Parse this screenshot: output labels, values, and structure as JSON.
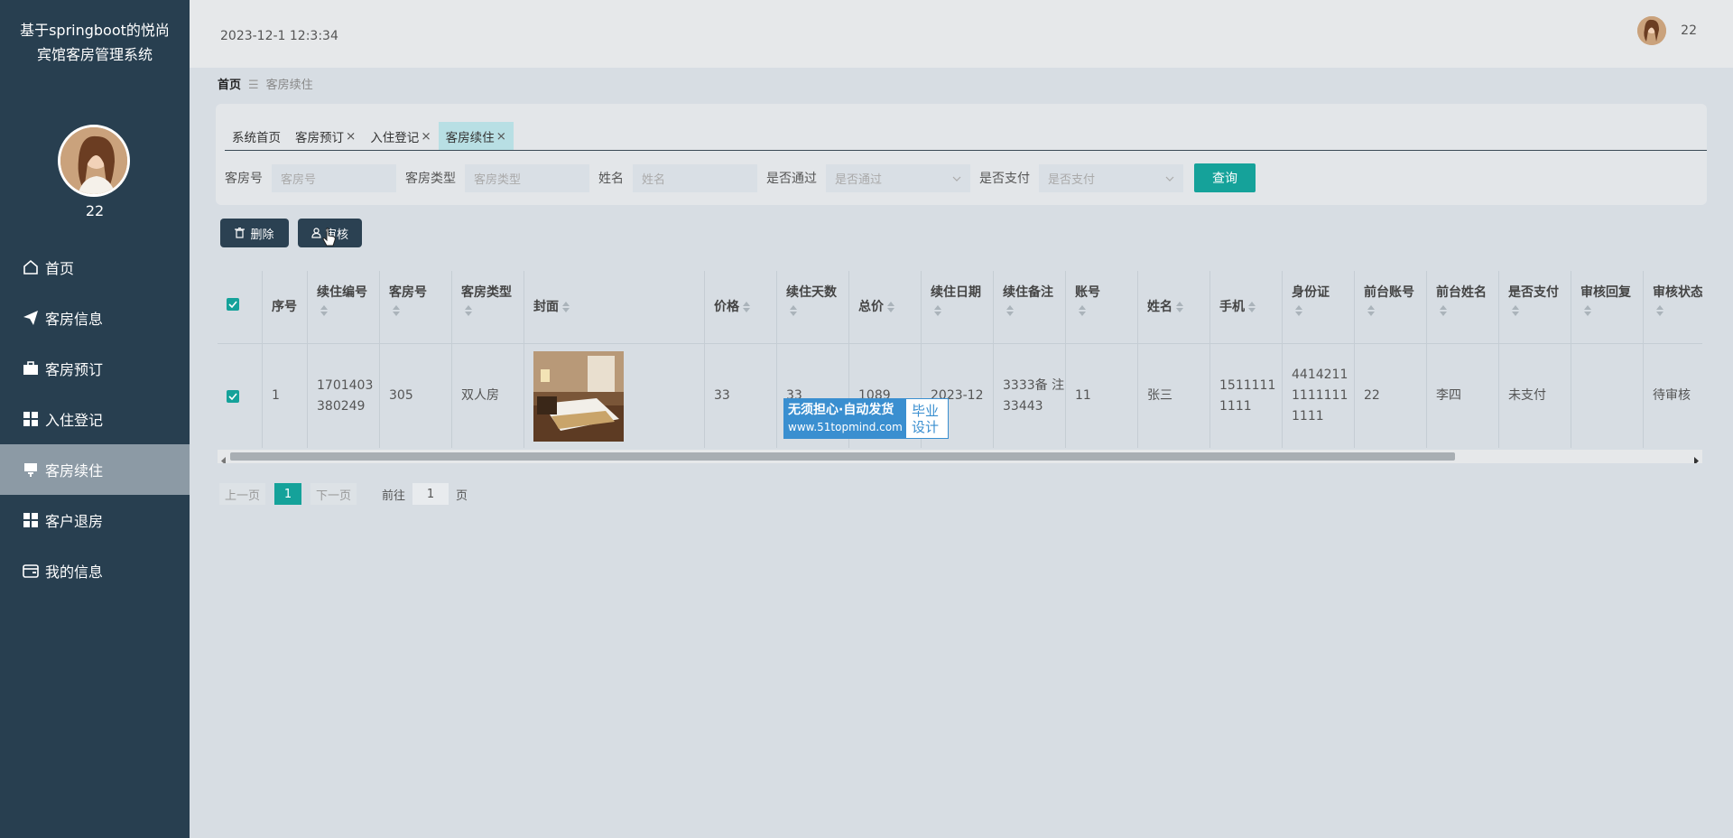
{
  "app": {
    "title": "基于springboot的悦尚宾馆客房管理系统",
    "user": "22"
  },
  "header": {
    "datetime": "2023-12-1 12:3:34",
    "user": "22"
  },
  "sidebar": {
    "items": [
      {
        "label": "首页",
        "icon": "home-icon"
      },
      {
        "label": "客房信息",
        "icon": "paper-plane-icon"
      },
      {
        "label": "客房预订",
        "icon": "briefcase-icon"
      },
      {
        "label": "入住登记",
        "icon": "grid-icon"
      },
      {
        "label": "客房续住",
        "icon": "monitor-icon",
        "active": true
      },
      {
        "label": "客户退房",
        "icon": "grid-icon"
      },
      {
        "label": "我的信息",
        "icon": "wallet-icon"
      }
    ]
  },
  "breadcrumb": {
    "home": "首页",
    "separator": "☰",
    "current": "客房续住"
  },
  "tabs": [
    {
      "label": "系统首页",
      "closable": false
    },
    {
      "label": "客房预订",
      "closable": true
    },
    {
      "label": "入住登记",
      "closable": true
    },
    {
      "label": "客房续住",
      "closable": true,
      "active": true
    }
  ],
  "close_glyph": "×",
  "search": {
    "room_no_label": "客房号",
    "room_no_placeholder": "客房号",
    "room_type_label": "客房类型",
    "room_type_placeholder": "客房类型",
    "name_label": "姓名",
    "name_placeholder": "姓名",
    "approved_label": "是否通过",
    "approved_placeholder": "是否通过",
    "paid_label": "是否支付",
    "paid_placeholder": "是否支付",
    "query_button": "查询"
  },
  "actions": {
    "delete": "删除",
    "review": "审核"
  },
  "table": {
    "headers": {
      "index": "序号",
      "renew_no": "续住编号",
      "room_no": "客房号",
      "room_type": "客房类型",
      "cover": "封面",
      "price": "价格",
      "days": "续住天数",
      "total": "总价",
      "date": "续住日期",
      "remark": "续住备注",
      "account": "账号",
      "name": "姓名",
      "phone": "手机",
      "id_card": "身份证",
      "desk_account": "前台账号",
      "desk_name": "前台姓名",
      "paid": "是否支付",
      "reply": "审核回复",
      "status": "审核状态"
    },
    "row": {
      "index": "1",
      "renew_no": "1701403 380249",
      "room_no": "305",
      "room_type": "双人房",
      "price": "33",
      "days": "33",
      "total": "1089",
      "date": "2023-12",
      "remark": "3333备 注33443",
      "account": "11",
      "name": "张三",
      "phone": "1511111 1111",
      "id_card": "4414211 1111111 1111",
      "desk_account": "22",
      "desk_name": "李四",
      "paid": "未支付",
      "reply": "",
      "status": "待审核"
    }
  },
  "pagination": {
    "prev": "上一页",
    "current": "1",
    "next": "下一页",
    "goto": "前往",
    "goto_value": "1",
    "page_unit": "页"
  },
  "watermark": {
    "line1": "无须担心·自动发货",
    "line2": "www.51topmind.com",
    "right": "毕业 设计"
  },
  "colors": {
    "sidebar": "#283f50",
    "accent": "#15a29a",
    "active_menu": "#8c9aa5"
  }
}
